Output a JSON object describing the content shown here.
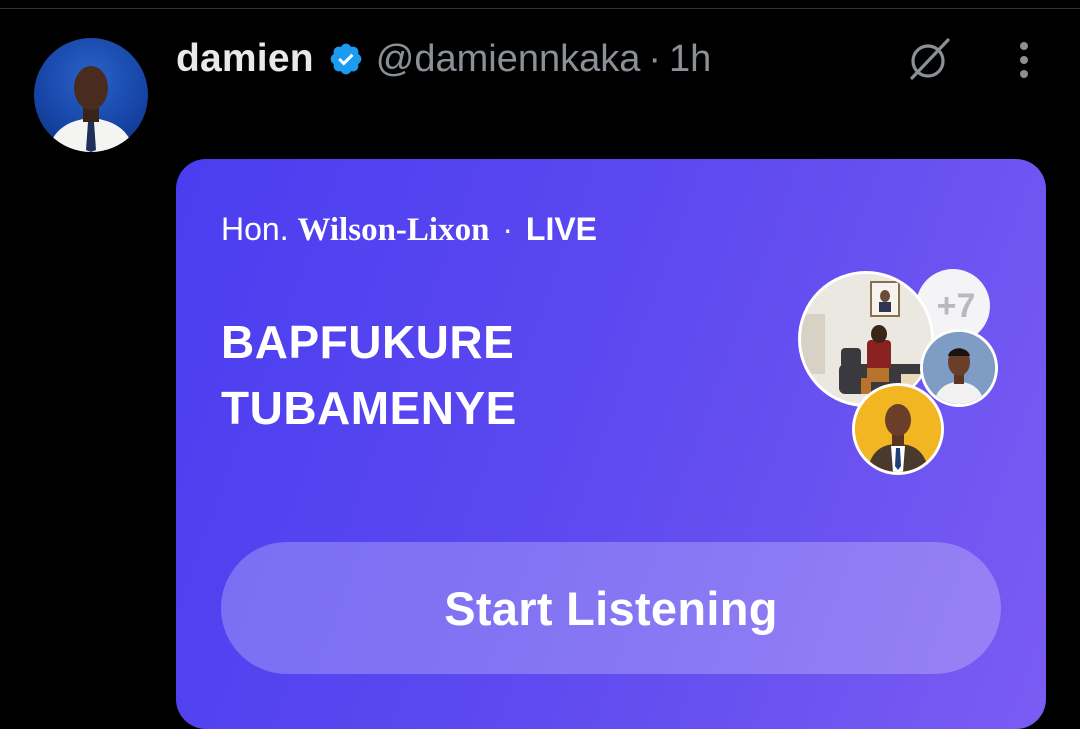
{
  "post": {
    "author": {
      "display_name": "damien",
      "handle": "@damiennkaka",
      "verified": true,
      "avatar": "profile-photo-man-in-white-shirt-blue-background"
    },
    "separator": "·",
    "time": "1h",
    "icons": {
      "verified": "verified-badge-icon",
      "grok": "grok-icon",
      "more": "more-vertical-icon"
    }
  },
  "space": {
    "host_prefix": "Hon.",
    "host_name": "Wilson-Lixon",
    "separator": "·",
    "status": "LIVE",
    "title_line1": "BAPFUKURE",
    "title_line2": "TUBAMENYE",
    "listener_count_label": "+7",
    "listener_avatars": [
      "man-seated-in-office-photo",
      "young-man-portrait",
      "man-in-vest-on-yellow-background"
    ],
    "cta_label": "Start Listening"
  },
  "colors": {
    "background": "#000000",
    "display_name": "#e7e9ea",
    "secondary_text": "#8b9096",
    "verified": "#1d9bf0",
    "card_gradient_start": "#4a3ef0",
    "card_gradient_end": "#7a5cf2"
  }
}
